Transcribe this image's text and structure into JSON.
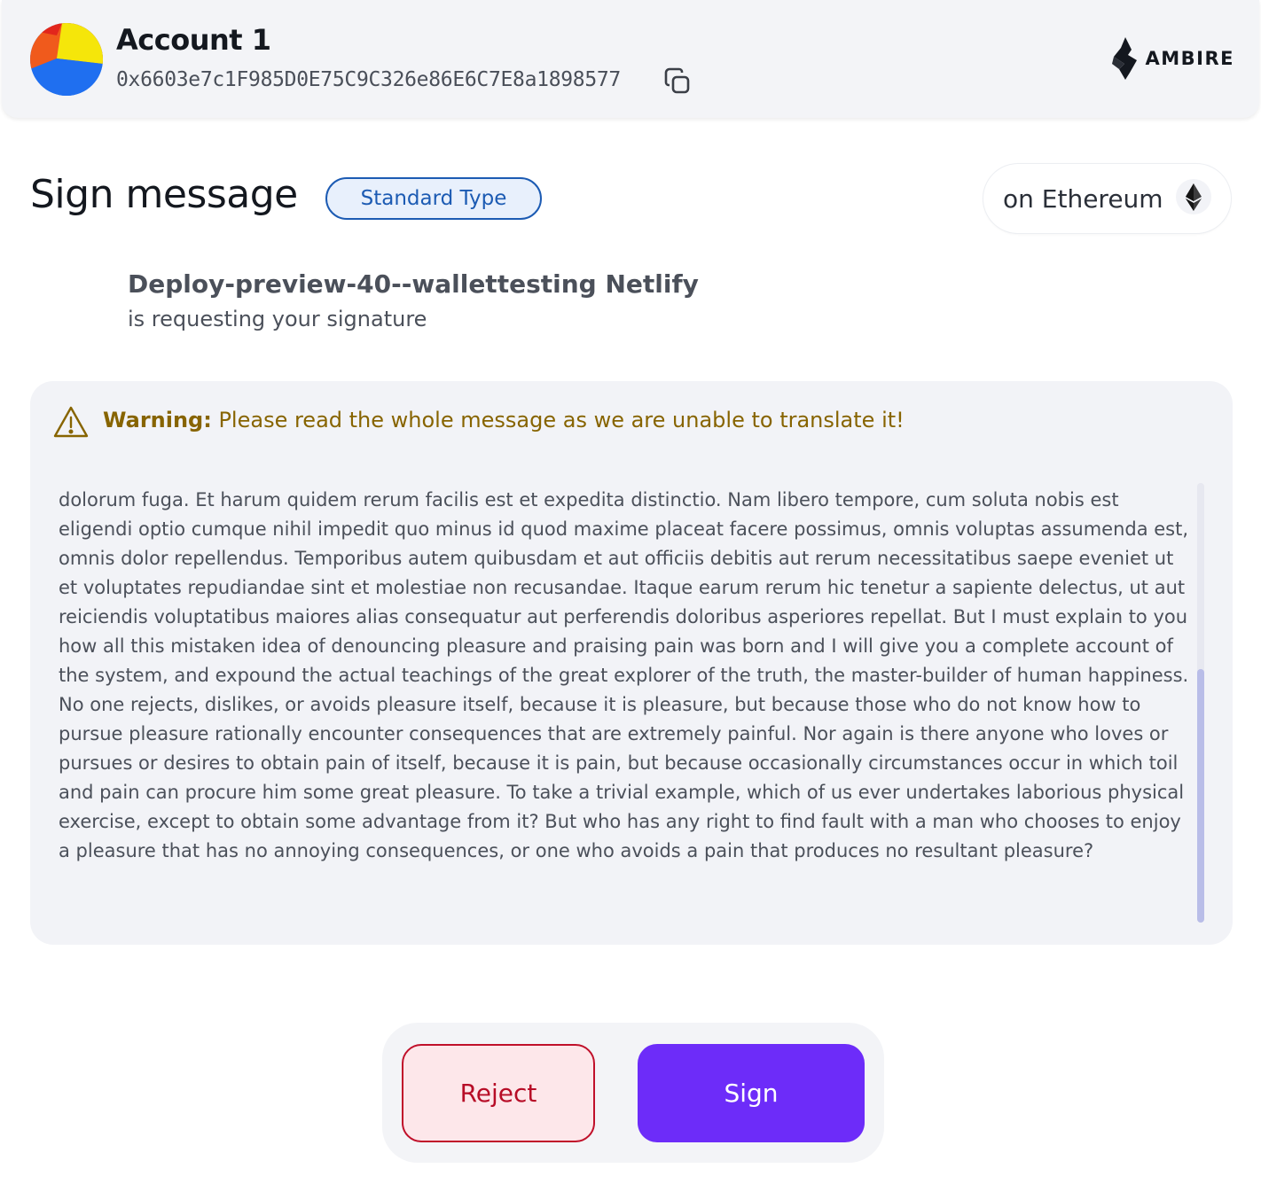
{
  "header": {
    "account_name": "Account 1",
    "account_address": "0x6603e7c1F985D0E75C9C326e86E6C7E8a1898577",
    "brand_name": "AMBIRE",
    "copy_icon": "copy-icon",
    "avatar_colors": [
      "#f5e60a",
      "#1f6ff0",
      "#f05a1c",
      "#e2261c"
    ]
  },
  "main": {
    "title": "Sign message",
    "type_badge": "Standard Type",
    "network_label": "on Ethereum",
    "network_icon": "ethereum-icon",
    "dapp_name": "Deploy-preview-40--wallettesting Netlify",
    "dapp_subtitle": "is requesting your signature"
  },
  "warning": {
    "label": "Warning:",
    "text": " Please read the whole message as we are unable to translate it!",
    "icon": "warning-icon",
    "color": "#876400"
  },
  "message": {
    "text": "dolorum fuga. Et harum quidem rerum facilis est et expedita distinctio. Nam libero tempore, cum soluta nobis est eligendi optio cumque nihil impedit quo minus id quod maxime placeat facere possimus, omnis voluptas assumenda est, omnis dolor repellendus. Temporibus autem quibusdam et aut officiis debitis aut rerum necessitatibus saepe eveniet ut et voluptates repudiandae sint et molestiae non recusandae. Itaque earum rerum hic tenetur a sapiente delectus, ut aut reiciendis voluptatibus maiores alias consequatur aut perferendis doloribus asperiores repellat. But I must explain to you how all this mistaken idea of denouncing pleasure and praising pain was born and I will give you a complete account of the system, and expound the actual teachings of the great explorer of the truth, the master-builder of human happiness. No one rejects, dislikes, or avoids pleasure itself, because it is pleasure, but because those who do not know how to pursue pleasure rationally encounter consequences that are extremely painful. Nor again is there anyone who loves or pursues or desires to obtain pain of itself, because it is pain, but because occasionally circumstances occur in which toil and pain can procure him some great pleasure. To take a trivial example, which of us ever undertakes laborious physical exercise, except to obtain some advantage from it? But who has any right to find fault with a man who chooses to enjoy a pleasure that has no annoying consequences, or one who avoids a pain that produces no resultant pleasure?"
  },
  "actions": {
    "reject_label": "Reject",
    "sign_label": "Sign",
    "reject_color": "#c0102a",
    "sign_color": "#6d2cf9"
  }
}
